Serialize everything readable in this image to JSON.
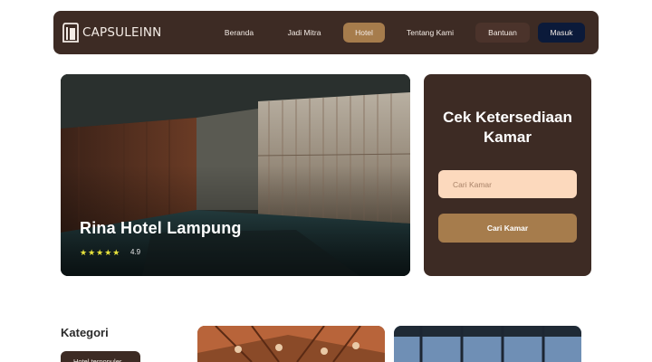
{
  "brand": {
    "name": "CAPSULEINN",
    "logo_icon": "capsule-logo-icon"
  },
  "nav": {
    "items": [
      {
        "label": "Beranda"
      },
      {
        "label": "Jadi Mitra"
      },
      {
        "label": "Hotel"
      },
      {
        "label": "Tentang Kami"
      },
      {
        "label": "Bantuan"
      },
      {
        "label": "Masuk"
      }
    ],
    "active": "Hotel"
  },
  "hero": {
    "hotel_name": "Rina Hotel Lampung",
    "stars": "★★★★★",
    "rating": "4.9"
  },
  "availability": {
    "title": "Cek Ketersediaan Kamar",
    "search_placeholder": "Cari Kamar",
    "search_button": "Cari Kamar"
  },
  "category": {
    "heading": "Kategori",
    "first_chip": "Hotel terpopuler"
  },
  "colors": {
    "primary": "#3d2b24",
    "accent": "#a67c4c",
    "input_bg": "#fcd9bd",
    "login_bg": "#0b1a3a",
    "star": "#e8e33c"
  }
}
